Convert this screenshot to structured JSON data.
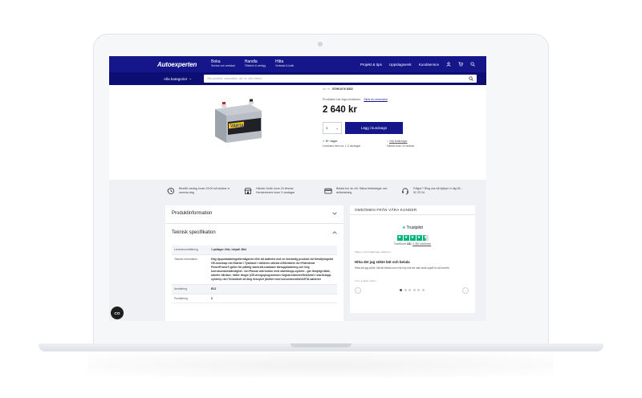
{
  "nav": {
    "logo": "Autoexperten",
    "items": [
      {
        "title": "Boka",
        "sub": "Service och verkstad"
      },
      {
        "title": "Handla",
        "sub": "Tillbehör & verktyg"
      },
      {
        "title": "Hitta",
        "sub": "Verkstad & butik"
      }
    ],
    "right": [
      "Projekt & tips",
      "Uppslagsverk",
      "Kundservice"
    ],
    "all_categories": "Alla kategorier",
    "search_placeholder": "Sök produkt, varumärke, art. nr. eller fritext"
  },
  "product": {
    "artno_label": "Art. nr.",
    "artno_value": "570901076 D852",
    "no_reviews": "Produkten har inga omdömen",
    "write_review": "Skriv en recension",
    "price": "2 640 kr",
    "qty": "1",
    "buy_label": "Lägg i kundvagn",
    "stock_status": "5+ i lager",
    "stock_note": "Leverans hem ca. 1-3 vardagar",
    "store_label": "Välj Butik/lager",
    "store_note": "Hämta inom 24 timmar",
    "brand": "VARTA"
  },
  "usps": [
    {
      "text": "Beställ vardag innan 15:00 så skickar vi samma dag"
    },
    {
      "text": "Hämta i butik inom 24 timmar Hemleverans inom 3 vardagar"
    },
    {
      "text": "Betala hur du vill. Säkra betalningar och delbetalning"
    },
    {
      "text": "Frågor? Ring oss så hjälper vi dig 08 - 92 33 34"
    }
  ],
  "accordion": {
    "info_title": "Produktinformation",
    "spec_title": "Teknisk specifikation",
    "rows": [
      {
        "k": "Leveransomfattning",
        "v": "1 pallager 16st, helpall 48st"
      },
      {
        "k": "Teknisk information",
        "v": "Hög djupurladdningsförmåga<br>Gör att batteriet mot en lösvärdig produkt vid försäljningstid OE-kunskap.<br>Startar i Tyskland i världens största AGM-fabrik.<br>Patenterat PowerFrame®-galler för pålitlig starkraft,snabbare återuppladdning och hög korrosionsbeständighet. <br>Passar alla fordon med start/stopp-system - gör lämpligt både, arbeter hårdare, håller längre (OE-designprogrammen högsta bränsleeffektivitet i start/stopp-system).<br>Tredubbelt så lång livscykel jämfört med konventionellaVARTA-batterier"
      },
      {
        "k": "Anslutning",
        "v": "B13"
      },
      {
        "k": "Poolaltning",
        "v": "0"
      }
    ]
  },
  "reviews": {
    "title": "OMDÖMEN FRÅN VÅRA KUNDER",
    "tp_name": "Trustpilot",
    "score_label": "TrustScore",
    "score": "4.6",
    "count": "4 384 omdömen",
    "note": "Våra 4- och 5-stjärniga omdömen",
    "head": "Hitta det jag sökte lätt och betala",
    "body": "Hitta det jag sökte, lätt att betala som inte köp inte att man skall upprå en så korrekt.",
    "date": "Lina, 3 dagar sedan"
  },
  "chat_label": "CO",
  "colors": {
    "brand": "#14168a",
    "trustpilot": "#00b67a",
    "in_stock": "#1a9a47"
  }
}
